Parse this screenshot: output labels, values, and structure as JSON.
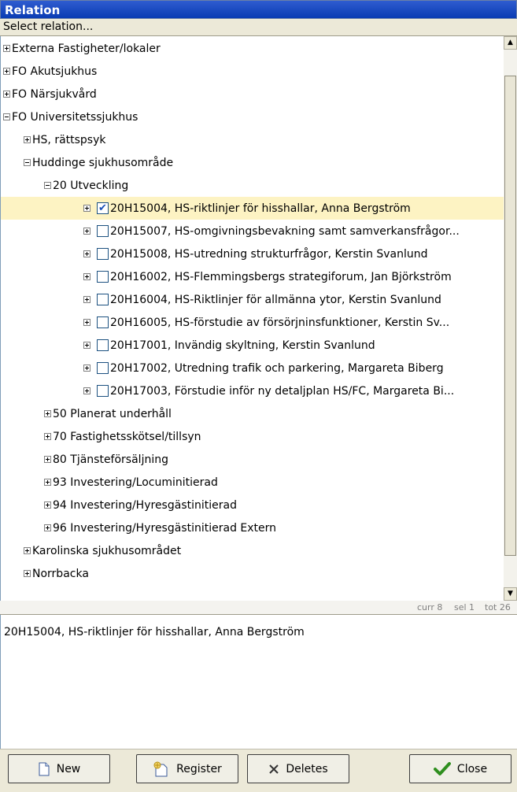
{
  "window": {
    "title": "Relation"
  },
  "select_prompt": "Select relation...",
  "tree": [
    {
      "label": "Externa Fastigheter/lokaler",
      "level": 0,
      "expander": "plus",
      "checkbox": null
    },
    {
      "label": "FO Akutsjukhus",
      "level": 0,
      "expander": "plus",
      "checkbox": null
    },
    {
      "label": "FO Närsjukvård",
      "level": 0,
      "expander": "plus",
      "checkbox": null
    },
    {
      "label": "FO Universitetssjukhus",
      "level": 0,
      "expander": "minus",
      "checkbox": null
    },
    {
      "label": "HS, rättspsyk",
      "level": 1,
      "expander": "plus",
      "checkbox": null
    },
    {
      "label": "Huddinge sjukhusområde",
      "level": 1,
      "expander": "minus",
      "checkbox": null
    },
    {
      "label": "20 Utveckling",
      "level": 2,
      "expander": "minus",
      "checkbox": null
    },
    {
      "label": "20H15004, HS-riktlinjer för hisshallar, Anna Bergström",
      "level": 3,
      "expander": "plus",
      "checkbox": true,
      "selected": true
    },
    {
      "label": "20H15007, HS-omgivningsbevakning samt samverkansfrågor...",
      "level": 3,
      "expander": "plus",
      "checkbox": false
    },
    {
      "label": "20H15008, HS-utredning strukturfrågor, Kerstin Svanlund",
      "level": 3,
      "expander": "plus",
      "checkbox": false
    },
    {
      "label": "20H16002, HS-Flemmingsbergs strategiforum, Jan Björkström",
      "level": 3,
      "expander": "plus",
      "checkbox": false
    },
    {
      "label": "20H16004, HS-Riktlinjer för allmänna ytor, Kerstin Svanlund",
      "level": 3,
      "expander": "plus",
      "checkbox": false
    },
    {
      "label": "20H16005, HS-förstudie av försörjninsfunktioner, Kerstin Sv...",
      "level": 3,
      "expander": "plus",
      "checkbox": false
    },
    {
      "label": "20H17001, Invändig skyltning, Kerstin Svanlund",
      "level": 3,
      "expander": "plus",
      "checkbox": false
    },
    {
      "label": "20H17002, Utredning trafik och parkering, Margareta Biberg",
      "level": 3,
      "expander": "plus",
      "checkbox": false
    },
    {
      "label": "20H17003, Förstudie inför ny detaljplan HS/FC, Margareta Bi...",
      "level": 3,
      "expander": "plus",
      "checkbox": false
    },
    {
      "label": "50 Planerat underhåll",
      "level": 2,
      "expander": "plus",
      "checkbox": null
    },
    {
      "label": "70 Fastighetsskötsel/tillsyn",
      "level": 2,
      "expander": "plus",
      "checkbox": null
    },
    {
      "label": "80 Tjänsteförsäljning",
      "level": 2,
      "expander": "plus",
      "checkbox": null
    },
    {
      "label": "93 Investering/Locuminitierad",
      "level": 2,
      "expander": "plus",
      "checkbox": null
    },
    {
      "label": "94 Investering/Hyresgästinitierad",
      "level": 2,
      "expander": "plus",
      "checkbox": null
    },
    {
      "label": "96 Investering/Hyresgästinitierad Extern",
      "level": 2,
      "expander": "plus",
      "checkbox": null
    },
    {
      "label": "Karolinska sjukhusområdet",
      "level": 1,
      "expander": "plus",
      "checkbox": null
    },
    {
      "label": "Norrbacka",
      "level": 1,
      "expander": "plus",
      "checkbox": null
    }
  ],
  "status": {
    "curr": "curr 8",
    "sel": "sel 1",
    "tot": "tot 26"
  },
  "description": "20H15004, HS-riktlinjer för hisshallar, Anna Bergström",
  "buttons": {
    "new": "New",
    "register": "Register",
    "deletes": "Deletes",
    "close": "Close"
  },
  "icons": {
    "new": "document-icon",
    "register": "register-icon",
    "deletes": "delete-x-icon",
    "close": "checkmark-icon",
    "scroll_up": "scroll-up-arrow-icon",
    "scroll_down": "scroll-down-arrow-icon"
  }
}
